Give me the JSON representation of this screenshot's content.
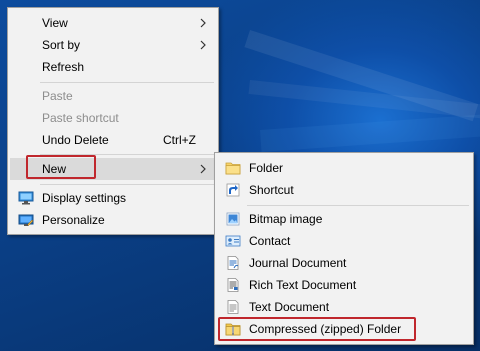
{
  "context_menu": {
    "items": [
      {
        "label": "View",
        "has_submenu": true,
        "enabled": true
      },
      {
        "label": "Sort by",
        "has_submenu": true,
        "enabled": true
      },
      {
        "label": "Refresh",
        "enabled": true
      },
      {
        "label": "Paste",
        "enabled": false
      },
      {
        "label": "Paste shortcut",
        "enabled": false
      },
      {
        "label": "Undo Delete",
        "shortcut": "Ctrl+Z",
        "enabled": true
      },
      {
        "label": "New",
        "has_submenu": true,
        "enabled": true,
        "highlighted": true
      },
      {
        "label": "Display settings",
        "icon": "display-settings-icon",
        "enabled": true
      },
      {
        "label": "Personalize",
        "icon": "personalize-icon",
        "enabled": true
      }
    ]
  },
  "new_submenu": {
    "items": [
      {
        "label": "Folder",
        "icon": "folder-icon"
      },
      {
        "label": "Shortcut",
        "icon": "shortcut-icon"
      },
      {
        "label": "Bitmap image",
        "icon": "bitmap-image-icon"
      },
      {
        "label": "Contact",
        "icon": "contact-icon"
      },
      {
        "label": "Journal Document",
        "icon": "journal-document-icon"
      },
      {
        "label": "Rich Text Document",
        "icon": "rich-text-document-icon"
      },
      {
        "label": "Text Document",
        "icon": "text-document-icon"
      },
      {
        "label": "Compressed (zipped) Folder",
        "icon": "zip-folder-icon",
        "highlighted": true
      }
    ]
  },
  "colors": {
    "menu_background": "#f2f2f2",
    "hover_background": "#dadada",
    "highlight_border": "#c0272d",
    "disabled_text": "#8d8d8d",
    "desktop_blue": "#0b3a78"
  }
}
